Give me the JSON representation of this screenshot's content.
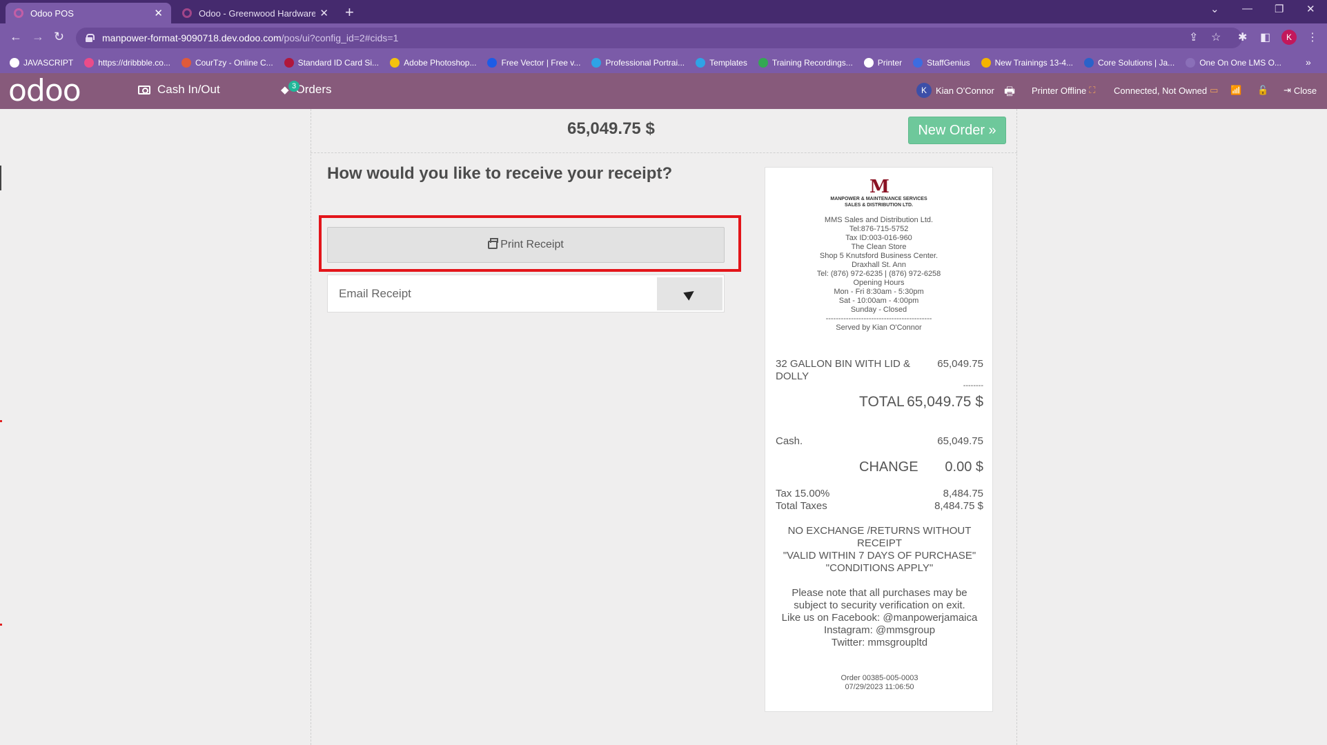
{
  "browser": {
    "tabs": [
      {
        "label": "Odoo POS",
        "active": true
      },
      {
        "label": "Odoo - Greenwood Hardware",
        "active": false
      }
    ],
    "url_host": "manpower-format-9090718.dev.odoo.com",
    "url_path": "/pos/ui?config_id=2#cids=1",
    "profile_initial": "K",
    "bookmarks": [
      {
        "label": "JAVASCRIPT",
        "color": "#ffffff"
      },
      {
        "label": "https://dribbble.co...",
        "color": "#ea4c89"
      },
      {
        "label": "CourTzy - Online C...",
        "color": "#e05a3a"
      },
      {
        "label": "Standard ID Card Si...",
        "color": "#b0173b"
      },
      {
        "label": "Adobe Photoshop...",
        "color": "#f4c20d"
      },
      {
        "label": "Free Vector | Free v...",
        "color": "#1d5ce6"
      },
      {
        "label": "Professional Portrai...",
        "color": "#2fa3e6"
      },
      {
        "label": "Templates",
        "color": "#2fa3e6"
      },
      {
        "label": "Training Recordings...",
        "color": "#34a853"
      },
      {
        "label": "Printer",
        "color": "#ffffff"
      },
      {
        "label": "StaffGenius",
        "color": "#3d6ce0"
      },
      {
        "label": "New Trainings 13-4...",
        "color": "#f4b400"
      },
      {
        "label": "Core Solutions | Ja...",
        "color": "#2a62c9"
      },
      {
        "label": "One On One LMS O...",
        "color": "#8a6fb8"
      }
    ]
  },
  "header": {
    "logo": "odoo",
    "cash_label": "Cash In/Out",
    "orders_label": "Orders",
    "orders_count": "3",
    "cashier_initial": "K",
    "cashier": "Kian O'Connor",
    "printer_status": "Printer Offline",
    "connection_status": "Connected, Not Owned",
    "close_label": "Close"
  },
  "screen": {
    "amount": "65,049.75 $",
    "new_order_label": "New Order »",
    "question": "How would you like to receive your receipt?",
    "print_label": "Print Receipt",
    "email_placeholder": "Email Receipt"
  },
  "receipt": {
    "logo_mark": "M",
    "logo_line1": "MANPOWER & MAINTENANCE SERVICES",
    "logo_line2": "SALES & DISTRIBUTION LTD.",
    "header_lines": [
      "MMS Sales and Distribution Ltd.",
      "Tel:876-715-5752",
      "Tax ID:003-016-960",
      "The Clean Store",
      "Shop 5 Knutsford Business Center.",
      "Draxhall St. Ann",
      "Tel: (876) 972-6235 | (876) 972-6258",
      "Opening Hours",
      "Mon - Fri 8:30am - 5:30pm",
      "Sat - 10:00am - 4:00pm",
      "Sunday - Closed",
      "------------------------------------------",
      "Served by Kian O'Connor"
    ],
    "line_item_name": "32 GALLON BIN WITH LID & DOLLY",
    "line_item_price": "65,049.75",
    "separator": "--------",
    "total_label": "TOTAL",
    "total_value": "65,049.75 $",
    "payment_label": "Cash.",
    "payment_value": "65,049.75",
    "change_label": "CHANGE",
    "change_value": "0.00 $",
    "tax_label": "Tax 15.00%",
    "tax_value": "8,484.75",
    "total_taxes_label": "Total Taxes",
    "total_taxes_value": "8,484.75 $",
    "policy_lines": [
      "NO EXCHANGE /RETURNS WITHOUT",
      "RECEIPT",
      "\"VALID WITHIN 7 DAYS OF PURCHASE\"",
      "\"CONDITIONS APPLY\""
    ],
    "note_lines": [
      "Please note that all purchases may be",
      "subject to security verification on exit.",
      "Like us on Facebook: @manpowerjamaica",
      "Instagram: @mmsgroup",
      "Twitter: mmsgroupltd"
    ],
    "order_ref": "Order 00385-005-0003",
    "order_datetime": "07/29/2023 11:06:50"
  }
}
